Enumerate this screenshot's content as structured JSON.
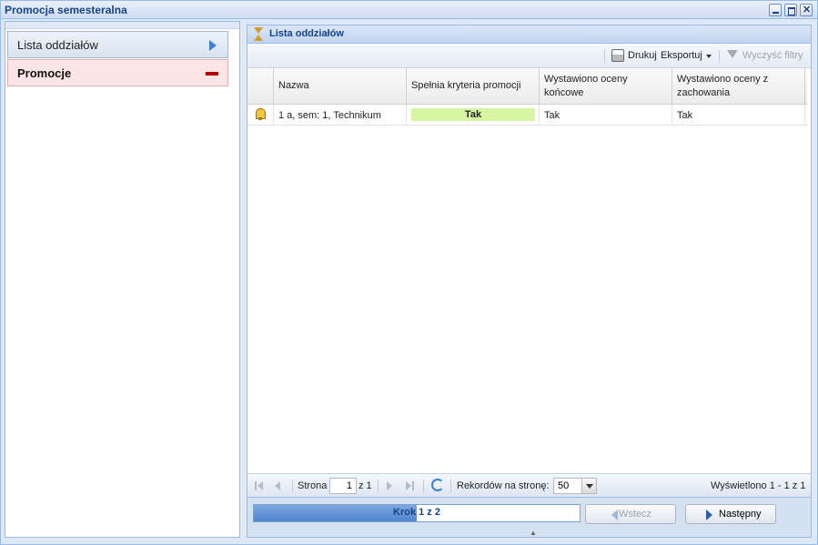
{
  "window": {
    "title": "Promocja semesteralna"
  },
  "steps": [
    {
      "label": "Lista oddziałów",
      "icon": "arrow-right-icon"
    },
    {
      "label": "Promocje",
      "icon": "minus-icon"
    }
  ],
  "panel": {
    "title": "Lista oddziałów",
    "toolbar": {
      "print_label": "Drukuj",
      "export_label": "Eksportuj",
      "clear_filters_label": "Wyczyść filtry"
    }
  },
  "grid": {
    "columns": [
      "",
      "Nazwa",
      "Spełnia kryteria promocji",
      "Wystawiono oceny końcowe",
      "Wystawiono oceny z zachowania"
    ],
    "rows": [
      {
        "icon": "bell-warning-icon",
        "nazwa": "1 a, sem: 1, Technikum",
        "kryteria": "Tak",
        "oceny_koncowe": "Tak",
        "oceny_zachowania": "Tak"
      }
    ]
  },
  "pager": {
    "page_label": "Strona",
    "page_value": "1",
    "of_label": "z 1",
    "per_page_label": "Rekordów na stronę:",
    "per_page_value": "50",
    "displayed": "Wyświetlono 1 - 1 z 1"
  },
  "wizard": {
    "progress_text": "Krok 1 z 2",
    "progress_fraction": 0.5,
    "back_label": "Wstecz",
    "next_label": "Następny"
  },
  "colors": {
    "accent": "#15428b",
    "active_step_bg": "#fde5e5",
    "success_cell": "#d8f5a3"
  }
}
